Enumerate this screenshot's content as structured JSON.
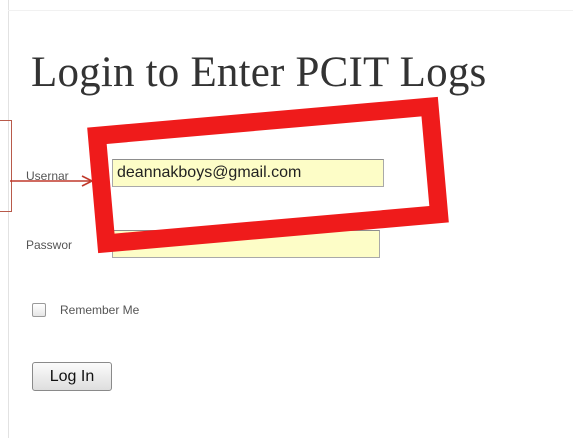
{
  "page": {
    "title": "Login to Enter PCIT Logs"
  },
  "form": {
    "username_label": "Usernar",
    "username_value": "deannakboys@gmail.com",
    "password_label": "Passwor",
    "password_value": "•••••••••",
    "remember_label": "Remember Me",
    "remember_checked": false,
    "submit_label": "Log In"
  },
  "annotation": {
    "highlight_color": "#ef1b1b",
    "arrow_color": "#c0392b"
  }
}
